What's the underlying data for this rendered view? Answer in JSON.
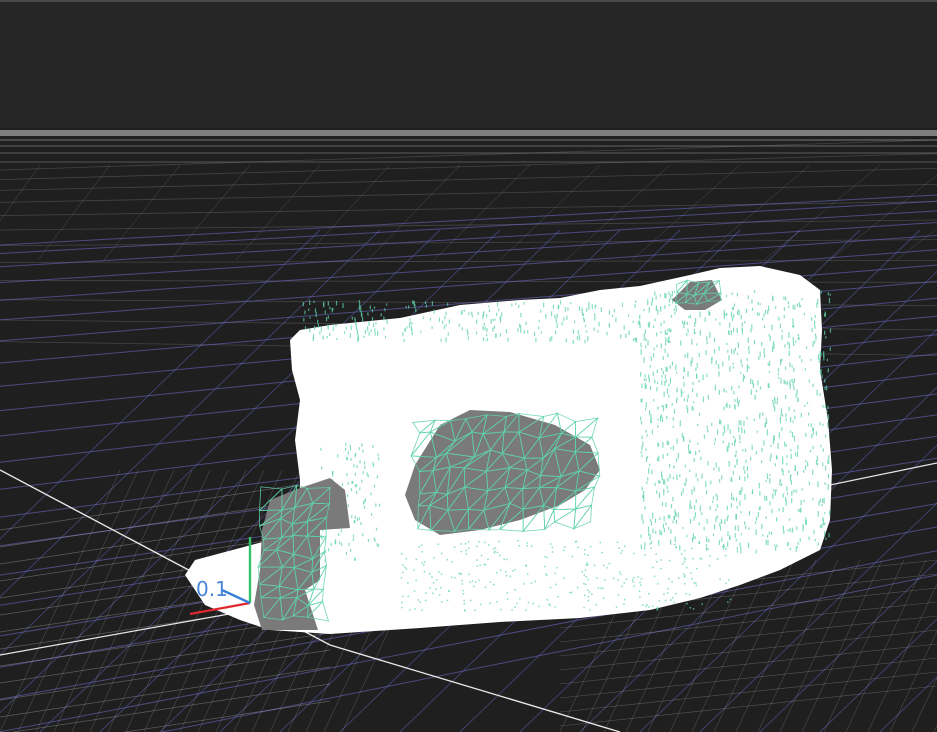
{
  "viewport": {
    "background_color": "#1f1f20",
    "top_strip_color": "#262627"
  },
  "grid": {
    "major_color": "#6f6fcf",
    "minor_color": "#8a8a90",
    "axis_line_color": "#e6e6e6",
    "horizon_color": "#9a9a9e"
  },
  "mesh": {
    "fill_color": "#ffffff",
    "wire_color": "#5fd3a8",
    "face_color": "#7a7a7a"
  },
  "axes_gizmo": {
    "x_color": "#e0282f",
    "y_color": "#33c46a",
    "z_color": "#3a7fd8",
    "scale_label": "0.1"
  }
}
